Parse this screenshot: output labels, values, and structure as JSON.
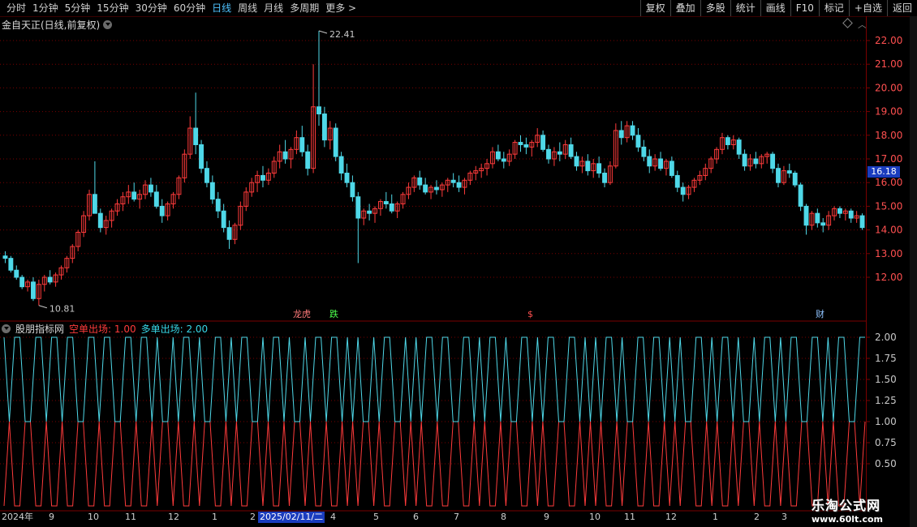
{
  "toolbar": {
    "periods": [
      "分时",
      "1分钟",
      "5分钟",
      "15分钟",
      "30分钟",
      "60分钟",
      "日线",
      "周线",
      "月线",
      "多周期",
      "更多 >"
    ],
    "active_period": "日线",
    "tools": [
      "复权",
      "叠加",
      "多股",
      "统计",
      "画线",
      "F10",
      "标记",
      "+自选",
      "返回"
    ]
  },
  "main": {
    "title": "金自天正(日线,前复权)",
    "current_price": "16.18",
    "high_label": "22.41",
    "low_label": "10.81",
    "markers": {
      "bang": "龙虎",
      "die": "跌",
      "dollar": "$",
      "cai": "财"
    }
  },
  "indicator": {
    "source": "股朋指标网",
    "kong_label": "空单出场: 1.00",
    "duo_label": "多单出场: 2.00"
  },
  "date_axis": {
    "labels": [
      "2024年",
      "9",
      "10",
      "11",
      "12",
      "1",
      "2",
      "4",
      "5",
      "6",
      "7",
      "8",
      "9",
      "10",
      "11",
      "12",
      "1",
      "2",
      "3"
    ],
    "highlight": "2025/02/11/二"
  },
  "watermark": {
    "line1": "乐淘公式网",
    "line2": "www.60lt.com"
  },
  "colors": {
    "up": "#ff3b3b",
    "down": "#4fd8e8",
    "grid": "#7a0000",
    "bg": "#000000"
  },
  "chart_data": [
    {
      "type": "candlestick",
      "title": "金自天正(日线,前复权)",
      "y_ticks": [
        12.0,
        13.0,
        14.0,
        15.0,
        16.0,
        17.0,
        18.0,
        19.0,
        20.0,
        21.0,
        22.0
      ],
      "ylim": [
        11.0,
        22.9
      ],
      "ohlc": [
        [
          12.9,
          13.1,
          12.6,
          12.8
        ],
        [
          12.8,
          12.9,
          12.2,
          12.3
        ],
        [
          12.3,
          12.5,
          11.9,
          12.0
        ],
        [
          12.0,
          12.1,
          11.5,
          11.6
        ],
        [
          11.6,
          11.9,
          11.4,
          11.8
        ],
        [
          11.8,
          12.0,
          11.0,
          11.1
        ],
        [
          11.1,
          11.9,
          10.81,
          11.7
        ],
        [
          11.7,
          12.1,
          11.4,
          12.0
        ],
        [
          12.0,
          12.3,
          11.7,
          11.8
        ],
        [
          11.8,
          12.2,
          11.6,
          12.1
        ],
        [
          12.1,
          12.5,
          11.9,
          12.4
        ],
        [
          12.4,
          12.9,
          12.2,
          12.8
        ],
        [
          12.8,
          13.4,
          12.6,
          13.3
        ],
        [
          13.3,
          14.0,
          13.1,
          13.9
        ],
        [
          13.9,
          14.8,
          13.7,
          14.6
        ],
        [
          14.6,
          15.7,
          14.4,
          15.5
        ],
        [
          15.5,
          16.9,
          15.2,
          14.7
        ],
        [
          14.7,
          14.9,
          13.9,
          14.1
        ],
        [
          14.1,
          14.6,
          13.8,
          14.4
        ],
        [
          14.4,
          14.9,
          14.1,
          14.8
        ],
        [
          14.8,
          15.3,
          14.6,
          15.1
        ],
        [
          15.1,
          15.6,
          14.8,
          15.4
        ],
        [
          15.4,
          15.9,
          15.1,
          15.6
        ],
        [
          15.6,
          16.0,
          15.2,
          15.3
        ],
        [
          15.3,
          15.7,
          14.9,
          15.5
        ],
        [
          15.5,
          16.1,
          15.3,
          15.9
        ],
        [
          15.9,
          16.2,
          15.4,
          15.6
        ],
        [
          15.6,
          15.9,
          14.9,
          15.0
        ],
        [
          15.0,
          15.3,
          14.3,
          14.6
        ],
        [
          14.6,
          15.2,
          14.4,
          15.1
        ],
        [
          15.1,
          15.6,
          14.9,
          15.5
        ],
        [
          15.5,
          16.3,
          15.3,
          16.2
        ],
        [
          16.2,
          17.4,
          16.0,
          17.2
        ],
        [
          17.2,
          18.8,
          17.0,
          18.3
        ],
        [
          18.3,
          19.8,
          17.2,
          17.6
        ],
        [
          17.6,
          17.8,
          16.4,
          16.6
        ],
        [
          16.6,
          16.9,
          15.8,
          16.0
        ],
        [
          16.0,
          16.3,
          15.1,
          15.3
        ],
        [
          15.3,
          15.6,
          14.5,
          14.8
        ],
        [
          14.8,
          15.1,
          13.9,
          14.1
        ],
        [
          14.1,
          14.4,
          13.2,
          13.6
        ],
        [
          13.6,
          14.3,
          13.4,
          14.2
        ],
        [
          14.2,
          15.2,
          14.0,
          15.0
        ],
        [
          15.0,
          15.8,
          14.8,
          15.6
        ],
        [
          15.6,
          16.2,
          15.4,
          16.0
        ],
        [
          16.0,
          16.5,
          15.6,
          16.3
        ],
        [
          16.3,
          16.7,
          15.8,
          16.1
        ],
        [
          16.1,
          16.6,
          15.9,
          16.4
        ],
        [
          16.4,
          17.1,
          16.2,
          16.9
        ],
        [
          16.9,
          17.6,
          16.6,
          17.3
        ],
        [
          17.3,
          17.8,
          16.8,
          17.0
        ],
        [
          17.0,
          17.5,
          16.6,
          17.4
        ],
        [
          17.4,
          18.2,
          17.2,
          17.9
        ],
        [
          17.9,
          18.4,
          17.1,
          17.3
        ],
        [
          17.3,
          17.6,
          16.3,
          16.6
        ],
        [
          16.6,
          21.0,
          16.4,
          19.2
        ],
        [
          19.2,
          22.41,
          18.4,
          18.9
        ],
        [
          18.9,
          19.2,
          17.5,
          17.8
        ],
        [
          17.8,
          18.6,
          17.4,
          18.3
        ],
        [
          18.3,
          18.5,
          16.9,
          17.1
        ],
        [
          17.1,
          17.3,
          16.1,
          16.4
        ],
        [
          16.4,
          16.8,
          15.8,
          16.0
        ],
        [
          16.0,
          16.3,
          15.2,
          15.4
        ],
        [
          15.4,
          15.6,
          12.6,
          14.5
        ],
        [
          14.5,
          14.9,
          14.2,
          14.8
        ],
        [
          14.8,
          15.1,
          14.4,
          14.7
        ],
        [
          14.7,
          15.0,
          14.3,
          14.9
        ],
        [
          14.9,
          15.3,
          14.6,
          15.2
        ],
        [
          15.2,
          15.6,
          14.9,
          15.1
        ],
        [
          15.1,
          15.5,
          14.7,
          14.8
        ],
        [
          14.8,
          15.2,
          14.5,
          15.1
        ],
        [
          15.1,
          15.6,
          14.9,
          15.5
        ],
        [
          15.5,
          16.0,
          15.3,
          15.8
        ],
        [
          15.8,
          16.3,
          15.6,
          16.2
        ],
        [
          16.2,
          16.5,
          15.7,
          15.9
        ],
        [
          15.9,
          16.2,
          15.5,
          15.6
        ],
        [
          15.6,
          15.9,
          15.3,
          15.8
        ],
        [
          15.8,
          16.1,
          15.5,
          15.7
        ],
        [
          15.7,
          16.0,
          15.4,
          15.9
        ],
        [
          15.9,
          16.2,
          15.6,
          16.1
        ],
        [
          16.1,
          16.4,
          15.8,
          16.0
        ],
        [
          16.0,
          16.3,
          15.6,
          15.8
        ],
        [
          15.8,
          16.2,
          15.5,
          16.1
        ],
        [
          16.1,
          16.5,
          15.9,
          16.4
        ],
        [
          16.4,
          16.7,
          16.1,
          16.5
        ],
        [
          16.5,
          16.8,
          16.2,
          16.6
        ],
        [
          16.6,
          17.0,
          16.3,
          16.8
        ],
        [
          16.8,
          17.5,
          16.6,
          17.3
        ],
        [
          17.3,
          17.6,
          16.9,
          17.0
        ],
        [
          17.0,
          17.3,
          16.6,
          16.9
        ],
        [
          16.9,
          17.4,
          16.7,
          17.2
        ],
        [
          17.2,
          17.8,
          17.0,
          17.7
        ],
        [
          17.7,
          18.0,
          17.3,
          17.6
        ],
        [
          17.6,
          17.9,
          17.2,
          17.5
        ],
        [
          17.5,
          17.8,
          17.1,
          17.7
        ],
        [
          17.7,
          18.3,
          17.5,
          18.0
        ],
        [
          18.0,
          18.2,
          17.3,
          17.4
        ],
        [
          17.4,
          17.6,
          16.8,
          17.0
        ],
        [
          17.0,
          17.5,
          16.7,
          17.3
        ],
        [
          17.3,
          17.7,
          16.9,
          17.2
        ],
        [
          17.2,
          17.8,
          17.0,
          17.6
        ],
        [
          17.6,
          17.9,
          17.0,
          17.1
        ],
        [
          17.1,
          17.3,
          16.5,
          16.7
        ],
        [
          16.7,
          17.1,
          16.4,
          16.9
        ],
        [
          16.9,
          17.2,
          16.3,
          16.5
        ],
        [
          16.5,
          17.0,
          16.2,
          16.8
        ],
        [
          16.8,
          17.1,
          16.2,
          16.4
        ],
        [
          16.4,
          16.6,
          15.8,
          16.0
        ],
        [
          16.0,
          16.9,
          15.9,
          16.7
        ],
        [
          16.7,
          18.5,
          16.6,
          18.2
        ],
        [
          18.2,
          18.6,
          17.6,
          17.9
        ],
        [
          17.9,
          18.6,
          17.7,
          18.4
        ],
        [
          18.4,
          18.6,
          17.8,
          18.0
        ],
        [
          18.0,
          18.3,
          17.3,
          17.5
        ],
        [
          17.5,
          17.8,
          16.9,
          17.1
        ],
        [
          17.1,
          17.4,
          16.4,
          16.7
        ],
        [
          16.7,
          17.2,
          16.5,
          17.0
        ],
        [
          17.0,
          17.3,
          16.5,
          16.6
        ],
        [
          16.6,
          17.0,
          16.3,
          16.9
        ],
        [
          16.9,
          17.1,
          16.2,
          16.3
        ],
        [
          16.3,
          16.5,
          15.6,
          15.8
        ],
        [
          15.8,
          16.0,
          15.2,
          15.5
        ],
        [
          15.5,
          15.9,
          15.3,
          15.8
        ],
        [
          15.8,
          16.2,
          15.6,
          16.1
        ],
        [
          16.1,
          16.5,
          15.9,
          16.3
        ],
        [
          16.3,
          16.8,
          16.1,
          16.6
        ],
        [
          16.6,
          17.1,
          16.4,
          17.0
        ],
        [
          17.0,
          17.5,
          16.8,
          17.4
        ],
        [
          17.4,
          18.1,
          17.2,
          17.9
        ],
        [
          17.9,
          18.0,
          17.4,
          17.6
        ],
        [
          17.6,
          18.0,
          17.4,
          17.8
        ],
        [
          17.8,
          17.9,
          17.0,
          17.2
        ],
        [
          17.2,
          17.4,
          16.5,
          16.7
        ],
        [
          16.7,
          17.2,
          16.5,
          17.0
        ],
        [
          17.0,
          17.3,
          16.6,
          16.8
        ],
        [
          16.8,
          17.2,
          16.6,
          17.1
        ],
        [
          17.1,
          17.3,
          16.8,
          17.2
        ],
        [
          17.2,
          17.3,
          16.4,
          16.6
        ],
        [
          16.6,
          16.8,
          15.8,
          16.0
        ],
        [
          16.0,
          16.7,
          15.9,
          16.5
        ],
        [
          16.5,
          16.8,
          16.2,
          16.4
        ],
        [
          16.4,
          16.5,
          15.8,
          15.9
        ],
        [
          15.9,
          16.0,
          14.8,
          15.0
        ],
        [
          15.0,
          15.1,
          13.8,
          14.2
        ],
        [
          14.2,
          14.8,
          14.0,
          14.7
        ],
        [
          14.7,
          14.9,
          14.1,
          14.3
        ],
        [
          14.3,
          14.5,
          13.9,
          14.2
        ],
        [
          14.2,
          14.8,
          14.0,
          14.6
        ],
        [
          14.6,
          15.0,
          14.4,
          14.9
        ],
        [
          14.9,
          15.0,
          14.5,
          14.7
        ],
        [
          14.7,
          14.9,
          14.4,
          14.8
        ],
        [
          14.8,
          14.9,
          14.3,
          14.5
        ],
        [
          14.5,
          14.8,
          14.3,
          14.6
        ],
        [
          14.6,
          14.7,
          14.0,
          14.1
        ]
      ],
      "annotations": [
        "22.41",
        "10.81",
        "16.18"
      ]
    },
    {
      "type": "line",
      "title": "股朋指标网",
      "y_ticks": [
        0.5,
        0.75,
        1.0,
        1.25,
        1.5,
        1.75,
        2.0
      ],
      "series": [
        {
          "name": "空单出场",
          "color": "#ff3b3b",
          "values": [
            0,
            1,
            0,
            0,
            1,
            1,
            0,
            0,
            1,
            0,
            0,
            1,
            0,
            0,
            1,
            1,
            0,
            0,
            1,
            0,
            0,
            1,
            1,
            0,
            0,
            1,
            0,
            0,
            1,
            0,
            1,
            1,
            0,
            1,
            0,
            0,
            1,
            0,
            1,
            1,
            0,
            0,
            1,
            0,
            1,
            0,
            0,
            1,
            1,
            0,
            1,
            0,
            0,
            1,
            0,
            1,
            1,
            0,
            1,
            0,
            0,
            1,
            0,
            0,
            1,
            0,
            1,
            0,
            1,
            1,
            0,
            1,
            0,
            0,
            1,
            1,
            0,
            1,
            0,
            1,
            0,
            0,
            1,
            0,
            0,
            1,
            1,
            0,
            0,
            1,
            0,
            1,
            0,
            0,
            1,
            0,
            1,
            1,
            0,
            0,
            1,
            0,
            1,
            0,
            0,
            1,
            1,
            0,
            0,
            1,
            0,
            1,
            0,
            1,
            0,
            0,
            1,
            0,
            1,
            1,
            0,
            0,
            1,
            0,
            0,
            1,
            0,
            1,
            0,
            1,
            1,
            0,
            0,
            1,
            0,
            1,
            0,
            0,
            1,
            0,
            1,
            1,
            0,
            1,
            0,
            0,
            1,
            0,
            1,
            0,
            0,
            1,
            1,
            0,
            0,
            1,
            0,
            1,
            0,
            0,
            1,
            1,
            0,
            1
          ]
        },
        {
          "name": "多单出场",
          "color": "#4fd8e8",
          "values": [
            2,
            1,
            2,
            2,
            1,
            1,
            2,
            2,
            1,
            2,
            2,
            1,
            2,
            2,
            1,
            1,
            2,
            2,
            1,
            2,
            2,
            1,
            1,
            2,
            2,
            1,
            2,
            2,
            1,
            2,
            1,
            1,
            2,
            1,
            2,
            2,
            1,
            2,
            1,
            1,
            2,
            2,
            1,
            2,
            1,
            2,
            2,
            1,
            1,
            2,
            1,
            2,
            2,
            1,
            2,
            1,
            1,
            2,
            1,
            2,
            2,
            1,
            2,
            2,
            1,
            2,
            1,
            2,
            1,
            1,
            2,
            1,
            2,
            2,
            1,
            1,
            2,
            1,
            2,
            1,
            2,
            2,
            1,
            2,
            2,
            1,
            1,
            2,
            2,
            1,
            2,
            1,
            2,
            2,
            1,
            2,
            1,
            1,
            2,
            2,
            1,
            2,
            1,
            2,
            2,
            1,
            1,
            2,
            2,
            1,
            2,
            1,
            2,
            1,
            2,
            2,
            1,
            2,
            1,
            1,
            2,
            2,
            1,
            2,
            2,
            1,
            2,
            1,
            2,
            1,
            1,
            2,
            2,
            1,
            2,
            1,
            2,
            2,
            1,
            2,
            1,
            1,
            2,
            1,
            2,
            2,
            1,
            2,
            1,
            2,
            2,
            1,
            1,
            2,
            2,
            1,
            2,
            1,
            2,
            2,
            1,
            1,
            2,
            2
          ]
        }
      ]
    }
  ]
}
